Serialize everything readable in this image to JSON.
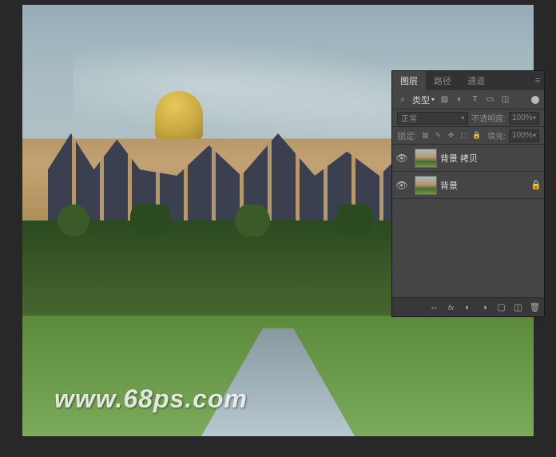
{
  "watermark": "www.68ps.com",
  "panel": {
    "tabs": {
      "layers": "图层",
      "paths": "路径",
      "channels": "通道"
    },
    "filter": {
      "search_icon": "⌕",
      "type_label": "类型"
    },
    "blend": {
      "mode": "正常",
      "opacity_label": "不透明度:",
      "opacity_value": "100%"
    },
    "lock": {
      "label": "锁定:",
      "fill_label": "填充:",
      "fill_value": "100%"
    },
    "layers": [
      {
        "name": "背景 拷贝",
        "visible": true,
        "locked": false
      },
      {
        "name": "背景",
        "visible": true,
        "locked": true
      }
    ]
  }
}
